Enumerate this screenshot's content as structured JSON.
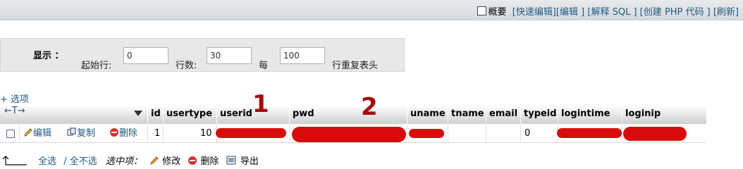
{
  "toolbar": {
    "summary_label": "概要",
    "quick_edit": "快速编辑",
    "edit": "编辑",
    "explain_sql": "解释 SQL",
    "create_php": "创建 PHP 代码",
    "refresh": "刷新"
  },
  "display": {
    "label": "显示 ：",
    "start_row_label": "起始行:",
    "start_row_value": "0",
    "row_count_label": "行数:",
    "row_count_value": "30",
    "every_label": "每",
    "repeat_value": "100",
    "repeat_label": "行重复表头"
  },
  "options_link": "+ 选项",
  "table": {
    "columns": [
      "id",
      "usertype",
      "userid",
      "pwd",
      "uname",
      "tname",
      "email",
      "typeid",
      "logintime",
      "loginip"
    ],
    "rows": [
      {
        "actions": {
          "edit": "编辑",
          "copy": "复制",
          "delete": "删除"
        },
        "id": "1",
        "usertype": "10",
        "typeid": "0"
      }
    ]
  },
  "annotations": {
    "one": "1",
    "two": "2"
  },
  "bottom": {
    "select_all": "全选",
    "deselect_all": "/ 全不选",
    "selected_label": "选中项：",
    "edit": "修改",
    "delete": "删除",
    "export": "导出"
  }
}
